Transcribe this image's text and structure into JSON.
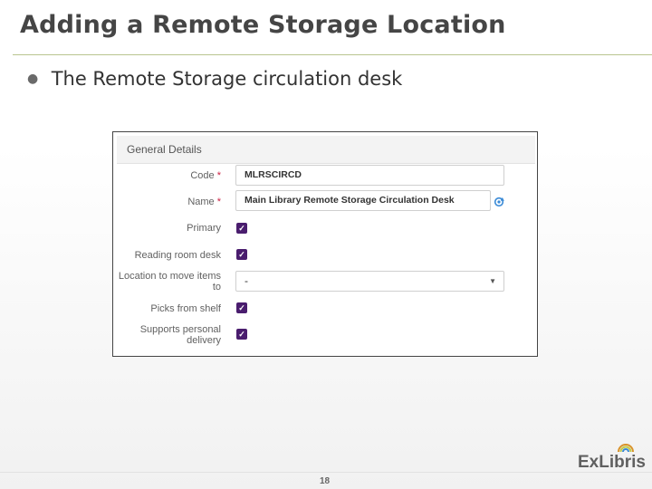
{
  "slide": {
    "title": "Adding a Remote Storage Location",
    "bullet": "The Remote Storage circulation desk",
    "page_number": "18",
    "logo_text": "ExLibris"
  },
  "form": {
    "section_title": "General Details",
    "fields": {
      "code": {
        "label": "Code",
        "required_mark": "*",
        "value": "MLRSCIRCD"
      },
      "name": {
        "label": "Name",
        "required_mark": "*",
        "value": "Main Library Remote Storage Circulation Desk"
      },
      "primary": {
        "label": "Primary",
        "checked": true
      },
      "reading_room_desk": {
        "label": "Reading room desk",
        "checked": true
      },
      "location_to_move_items_to": {
        "label_line1": "Location to move items",
        "label_line2": "to",
        "value": "-"
      },
      "picks_from_shelf": {
        "label": "Picks from shelf",
        "checked": true
      },
      "supports_personal_delivery": {
        "label_line1": "Supports personal",
        "label_line2": "delivery",
        "checked": true
      }
    },
    "checkmark_glyph": "✓",
    "dropdown_glyph": "▼"
  },
  "colors": {
    "title": "#454545",
    "title_rule": "#b9c48f",
    "checkbox": "#4a1d6e",
    "required": "#cc2244",
    "refresh_icon": "#3a8ad6"
  },
  "icons": [
    "refresh-icon",
    "chevron-down-icon",
    "checkmark-icon",
    "exlibris-logo"
  ]
}
